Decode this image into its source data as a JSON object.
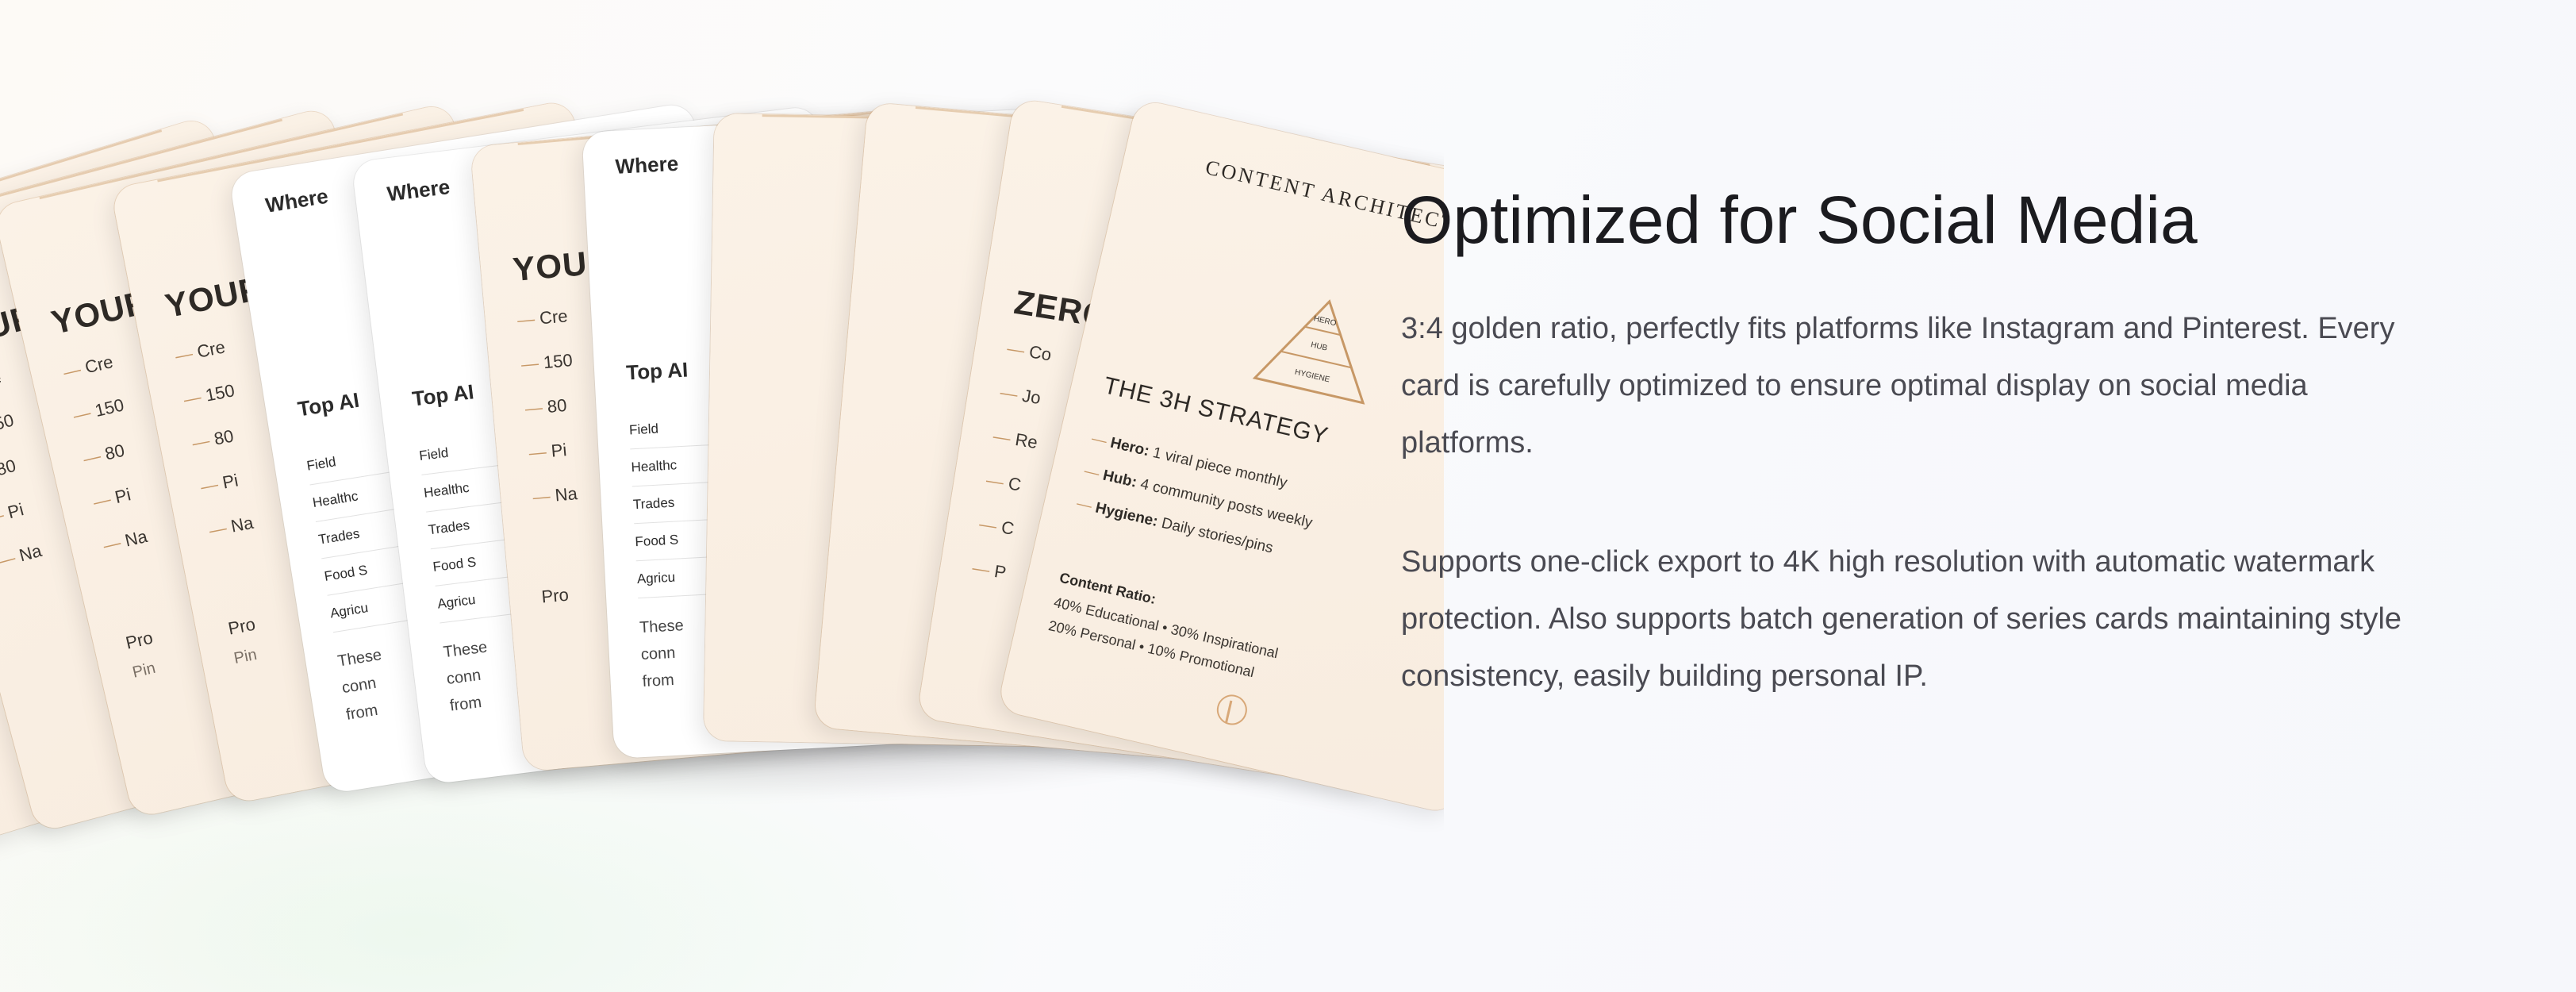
{
  "cards": {
    "back": {
      "title": "YOUR",
      "items": [
        "Cre",
        "150",
        "80",
        "Pi",
        "Na"
      ],
      "para": "Pro",
      "para2": "Pin"
    },
    "white": {
      "head": "Where",
      "sub": "Top AI",
      "rows": [
        "Field",
        "Healthc",
        "Trades",
        "Food S",
        "Agricu"
      ],
      "text": [
        "These",
        "conn",
        "from"
      ]
    },
    "zero": {
      "title": "ZERO",
      "items": [
        "Co",
        "Jo",
        "Re",
        "C",
        "C",
        "P"
      ]
    },
    "front": {
      "title": "CONTENT ARCHITECTURE",
      "pyramid": [
        "HERO",
        "HUB",
        "HYGIENE"
      ],
      "heading": "THE 3H STRATEGY",
      "items": [
        {
          "label": "Hero:",
          "text": " 1 viral piece monthly"
        },
        {
          "label": "Hub:",
          "text": " 4 community posts weekly"
        },
        {
          "label": "Hygiene:",
          "text": " Daily stories/pins"
        }
      ],
      "ratio_heading": "Content Ratio:",
      "ratio_line1": "40% Educational • 30% Inspirational",
      "ratio_line2": "20% Personal • 10% Promotional"
    }
  },
  "headline": "Optimized for Social Media",
  "paragraph1": "3:4 golden ratio, perfectly fits platforms like Instagram and Pinterest. Every card is carefully optimized to ensure optimal display on social media platforms.",
  "paragraph2": "Supports one-click export to 4K high resolution with automatic watermark protection. Also supports batch generation of series cards maintaining style consistency, easily building personal IP."
}
